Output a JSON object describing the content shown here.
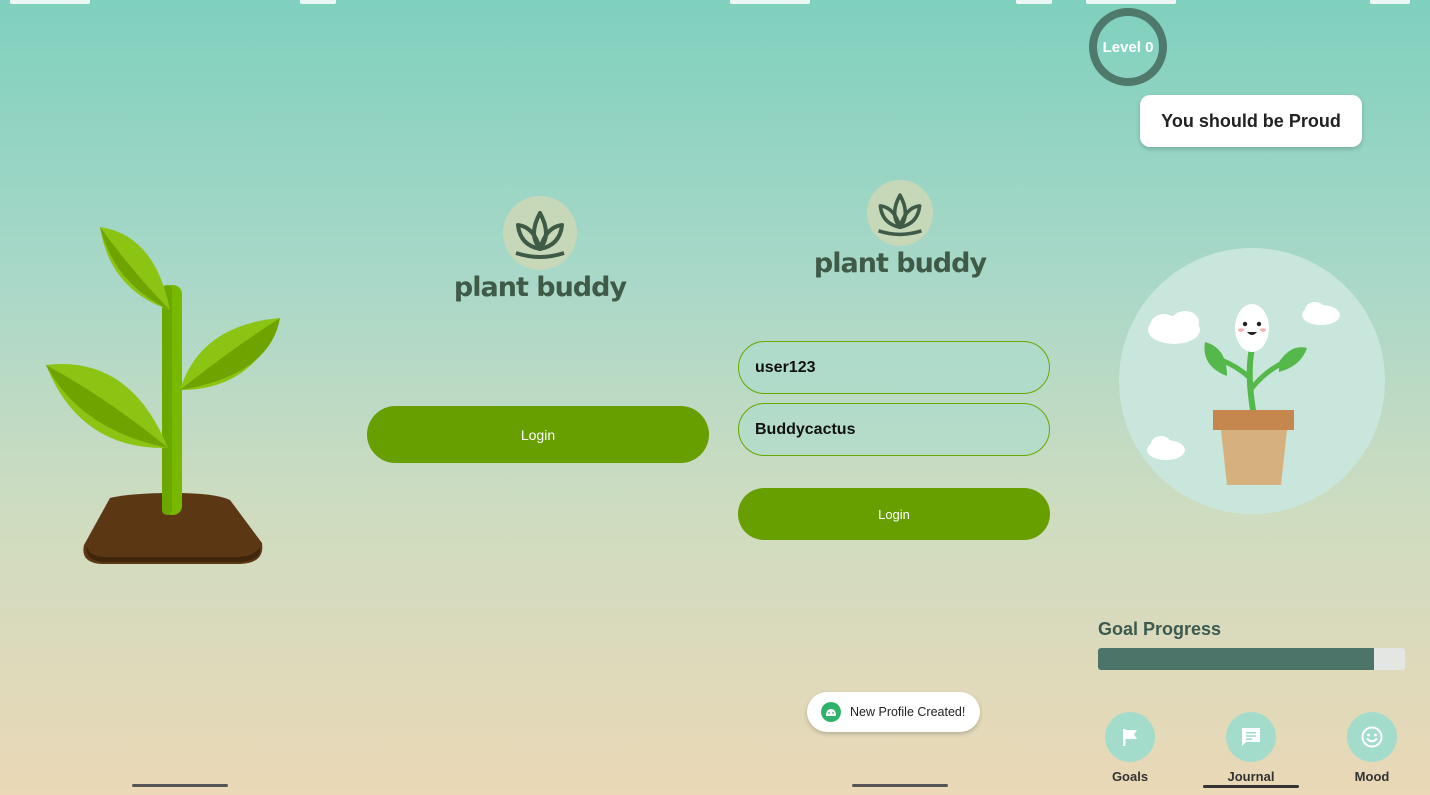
{
  "colors": {
    "accent_green": "#679e00",
    "logo_text": "#3f5a47",
    "progress_fill": "#4d7468",
    "toast_icon": "#2fb36b"
  },
  "screen2": {
    "logo_text": "plant buddy",
    "login_label": "Login"
  },
  "screen3": {
    "logo_text": "plant buddy",
    "username_value": "user123",
    "password_value": "Buddycactus",
    "login_label": "Login",
    "toast_text": "New Profile Created!",
    "toast_icon": "android-icon"
  },
  "screen4": {
    "level_label": "Level 0",
    "praise_text": "You should be Proud",
    "goal_progress_title": "Goal Progress",
    "goal_progress_fraction": 0.9,
    "nav": [
      {
        "label": "Goals",
        "icon": "flag-icon"
      },
      {
        "label": "Journal",
        "icon": "chat-icon",
        "active": true
      },
      {
        "label": "Mood",
        "icon": "smiley-icon"
      }
    ]
  }
}
